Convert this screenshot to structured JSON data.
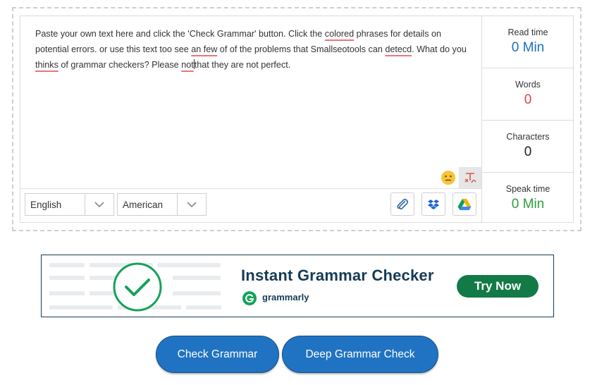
{
  "editor": {
    "segments": [
      {
        "text": "Paste your own text here and click the 'Check Grammar' button. Click the ",
        "error": false
      },
      {
        "text": "colored",
        "error": true
      },
      {
        "text": " phrases for details on potential errors. or use this text too see ",
        "error": false
      },
      {
        "text": "an few",
        "error": true
      },
      {
        "text": " of of the problems that Smallseotools can ",
        "error": false
      },
      {
        "text": "detecd",
        "error": true
      },
      {
        "text": ". What do you ",
        "error": false
      },
      {
        "text": "thinks",
        "error": true
      },
      {
        "text": " of grammar checkers? Please ",
        "error": false
      },
      {
        "text": "not",
        "error": true
      },
      {
        "text": "CARET",
        "error": false
      },
      {
        "text": "that they are not perfect.",
        "error": false
      }
    ]
  },
  "language_select": {
    "value": "English"
  },
  "variant_select": {
    "value": "American"
  },
  "toolbar": {
    "icons": [
      "paperclip-icon",
      "dropbox-icon",
      "google-drive-icon"
    ]
  },
  "stats": {
    "read_time": {
      "label": "Read time",
      "value": "0 Min",
      "color": "#1c6fbf"
    },
    "words": {
      "label": "Words",
      "value": "0",
      "color": "#e0433c"
    },
    "characters": {
      "label": "Characters",
      "value": "0",
      "color": "#222222"
    },
    "speak_time": {
      "label": "Speak time",
      "value": "0 Min",
      "color": "#2e9e3c"
    }
  },
  "ad": {
    "title": "Instant Grammar Checker",
    "brand": "grammarly",
    "cta": "Try Now",
    "colors": {
      "title": "#163a56",
      "cta": "#127a46",
      "check": "#15a25a"
    }
  },
  "actions": {
    "check_grammar": "Check Grammar",
    "deep_check": "Deep Grammar Check"
  }
}
